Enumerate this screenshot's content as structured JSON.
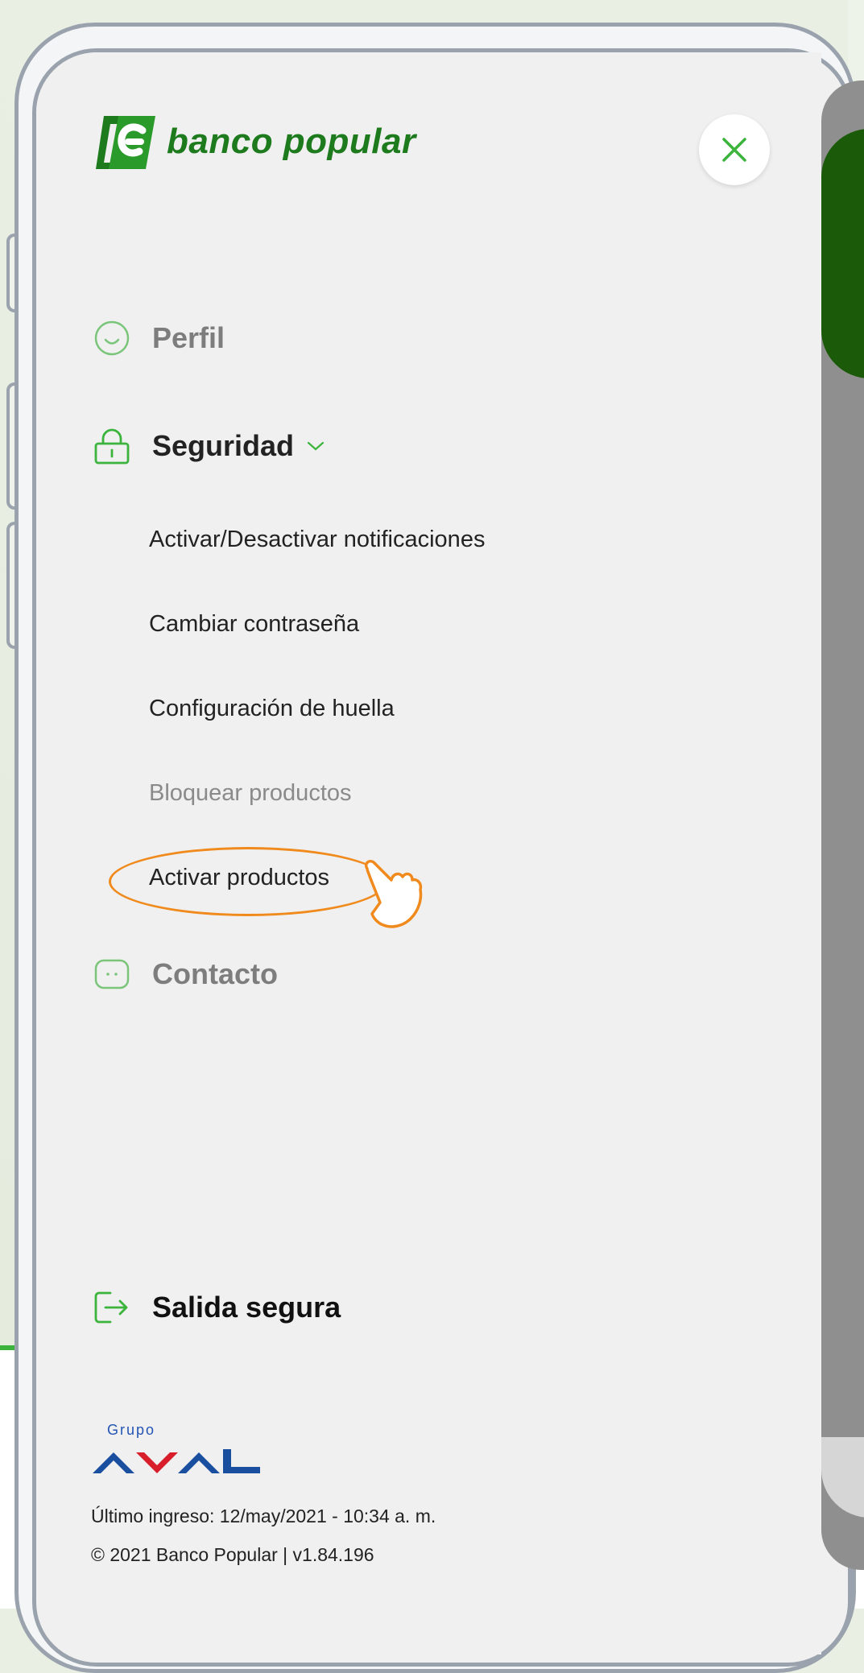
{
  "brand": {
    "logo_text": "banco popular"
  },
  "menu": {
    "perfil": "Perfil",
    "seguridad": "Seguridad",
    "contacto": "Contacto"
  },
  "seguridad_items": [
    {
      "label": "Activar/Desactivar notificaciones",
      "enabled": true
    },
    {
      "label": "Cambiar contraseña",
      "enabled": true
    },
    {
      "label": "Configuración de huella",
      "enabled": true
    },
    {
      "label": "Bloquear productos",
      "enabled": false
    },
    {
      "label": "Activar productos",
      "enabled": true,
      "highlighted": true
    }
  ],
  "exit_label": "Salida segura",
  "footer": {
    "grupo": "Grupo",
    "aval": "AVAL",
    "last_login": "Último ingreso: 12/may/2021 - 10:34 a. m.",
    "copyright": "© 2021 Banco Popular | v1.84.196"
  },
  "colors": {
    "brand_green": "#1d7a1d",
    "icon_green": "#3cb43c",
    "highlight_orange": "#f08a1c"
  },
  "icons": {
    "close": "close-icon",
    "perfil": "smiley-face-icon",
    "seguridad": "lock-icon",
    "chevron": "chevron-down-icon",
    "contacto": "chat-bubble-icon",
    "exit": "exit-icon",
    "cursor": "pointing-hand-icon"
  }
}
